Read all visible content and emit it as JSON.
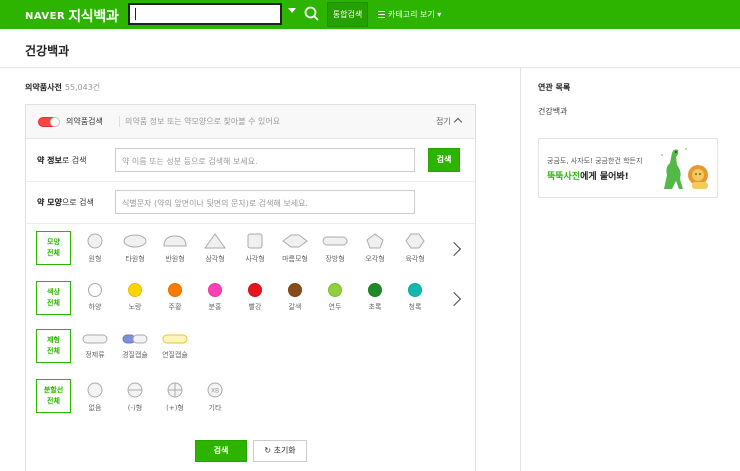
{
  "header": {
    "logo_brand": "NAVER",
    "logo_service": "지식백과",
    "search_value": "",
    "integrated_search_label": "통합검색",
    "category_view_label": "카테고리 보기"
  },
  "page": {
    "title": "건강백과"
  },
  "dictionary": {
    "title": "의약품사전",
    "count": "55,043건"
  },
  "drug_search": {
    "toggle_title": "의약품검색",
    "description": "의약품 정보 또는 약모양으로 찾아볼 수 있어요",
    "collapse_label": "접기",
    "info_label_bold": "약 정보",
    "info_label_rest": "로 검색",
    "info_placeholder": "약 이름 또는 성분 등으로 검색해 보세요.",
    "info_button": "검색",
    "shape_label_bold": "약 모양",
    "shape_label_rest": "으로 검색",
    "shape_placeholder": "식별문자 (약의 앞면이나 뒷면의 문자)로 검색해 보세요.",
    "shape_row": {
      "label_line1": "모양",
      "label_line2": "전체",
      "options": [
        "원형",
        "타원형",
        "반원형",
        "삼각형",
        "사각형",
        "마름모형",
        "장방형",
        "오각형",
        "육각형"
      ]
    },
    "color_row": {
      "label_line1": "색상",
      "label_line2": "전체",
      "options": [
        "하양",
        "노랑",
        "주황",
        "분홍",
        "빨강",
        "갈색",
        "연두",
        "초록",
        "청록"
      ],
      "colors": [
        "#ffffff",
        "#ffd400",
        "#ff7a00",
        "#ff3fb4",
        "#e8141b",
        "#8b4a1c",
        "#8fd13c",
        "#1f8a2a",
        "#14b7b0"
      ]
    },
    "form_row": {
      "label_line1": "제형",
      "label_line2": "전체",
      "options": [
        "정제류",
        "경질캡슐",
        "연질캡슐"
      ]
    },
    "split_row": {
      "label_line1": "분할선",
      "label_line2": "전체",
      "options": [
        "없음",
        "(-)형",
        "(+)형",
        "기타"
      ]
    },
    "submit_label": "검색",
    "reset_label": "초기화"
  },
  "sidebar": {
    "related_title": "연관 목록",
    "related_link": "건강백과",
    "ad_line1": "궁금도, 사자도! 궁금한건 학든지",
    "ad_line2_green": "뚝뚝사전",
    "ad_line2_rest": "에게 물어봐!"
  },
  "accent": "#2db400"
}
